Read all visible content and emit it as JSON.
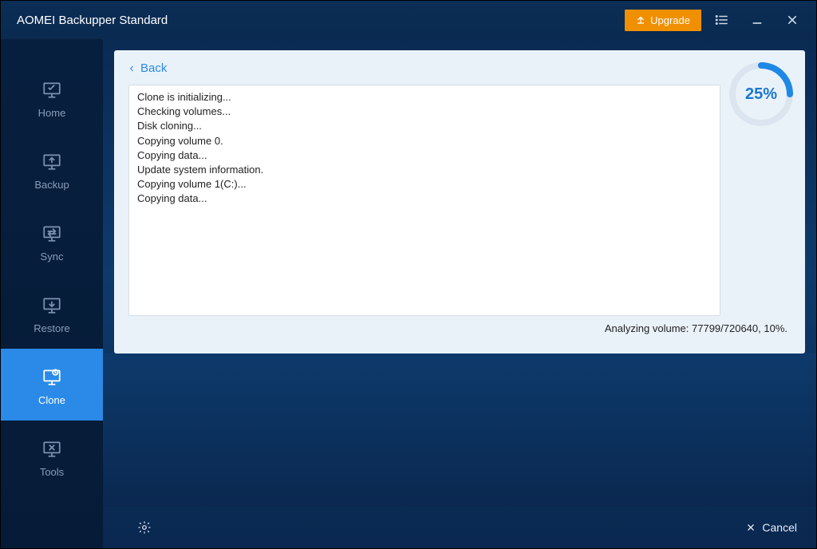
{
  "app": {
    "title": "AOMEI Backupper Standard"
  },
  "header": {
    "upgrade_label": "Upgrade"
  },
  "sidebar": {
    "items": [
      {
        "label": "Home"
      },
      {
        "label": "Backup"
      },
      {
        "label": "Sync"
      },
      {
        "label": "Restore"
      },
      {
        "label": "Clone"
      },
      {
        "label": "Tools"
      }
    ]
  },
  "panel": {
    "back_label": "Back",
    "progress_text": "25%",
    "progress_percent": 25,
    "log_lines": [
      "Clone is initializing...",
      "Checking volumes...",
      "Disk cloning...",
      "Copying volume 0.",
      "Copying data...",
      "Update system information.",
      "Copying volume 1(C:)...",
      "Copying data..."
    ],
    "status_text": "Analyzing volume: 77799/720640, 10%."
  },
  "footer": {
    "cancel_label": "Cancel"
  }
}
